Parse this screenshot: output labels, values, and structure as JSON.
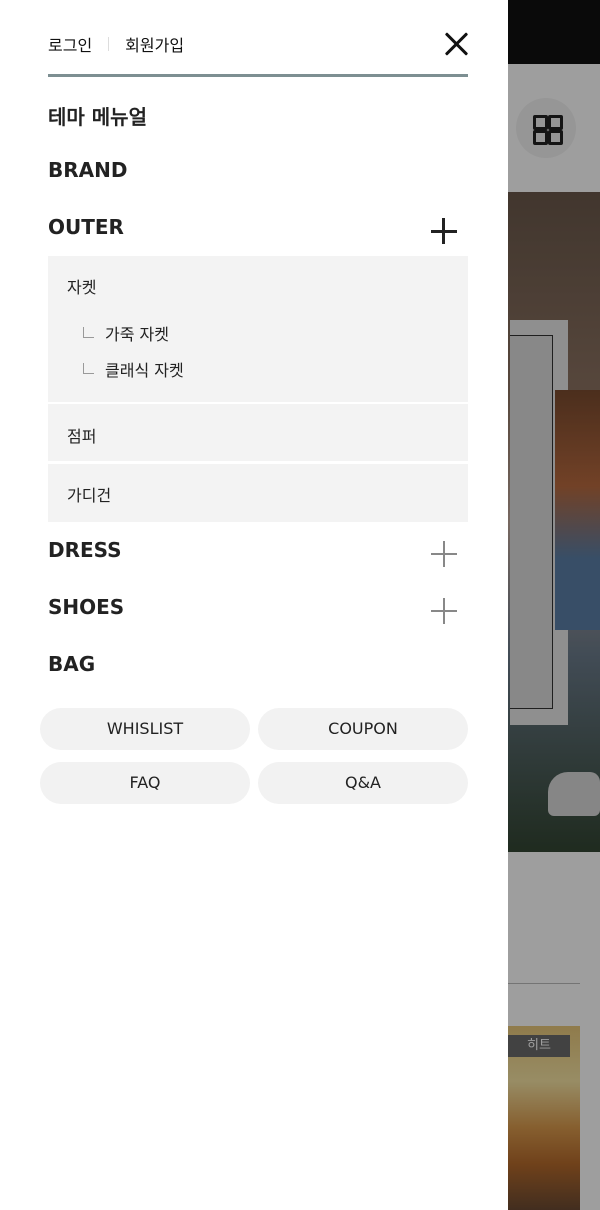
{
  "drawer": {
    "login": "로그인",
    "signup": "회원가입",
    "sections": {
      "theme": "테마 메뉴얼",
      "brand": "BRAND",
      "outer": "OUTER",
      "dress": "DRESS",
      "shoes": "SHOES",
      "bag": "BAG"
    },
    "outer_items": {
      "jacket": "자켓",
      "jacket_children": [
        "가죽 자켓",
        "클래식 자켓"
      ],
      "jumper": "점퍼",
      "cardigan": "가디건"
    },
    "buttons": [
      "WHISLIST",
      "COUPON",
      "FAQ",
      "Q&A"
    ]
  },
  "background": {
    "product_badge": "히트"
  },
  "colors": {
    "top_line": "#7d8f92",
    "submenu_bg": "#f3f3f3",
    "pill_bg": "#f2f2f2"
  }
}
